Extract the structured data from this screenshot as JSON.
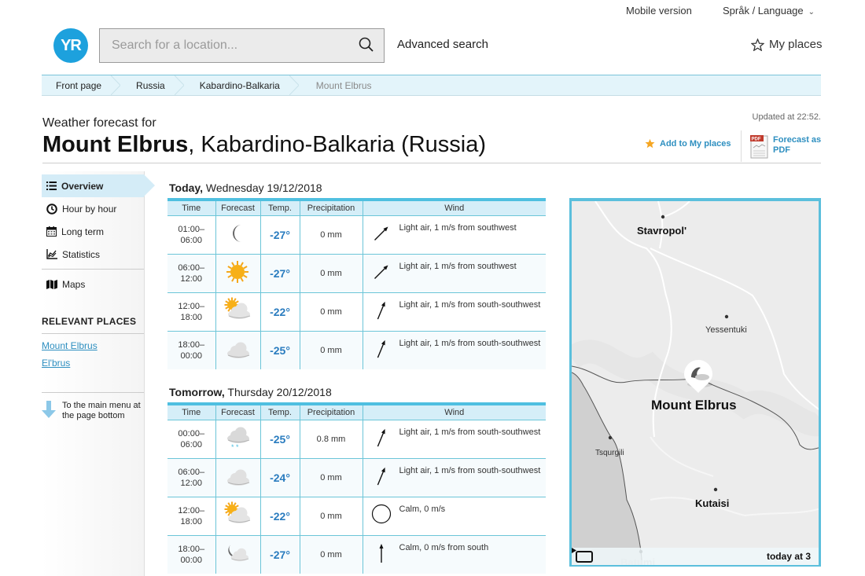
{
  "header": {
    "logo_text": "YR",
    "mobile_version": "Mobile version",
    "language": "Språk / Language",
    "search_placeholder": "Search for a location...",
    "search_value": "",
    "advanced_search": "Advanced search",
    "my_places": "My places"
  },
  "breadcrumb": [
    {
      "label": "Front page"
    },
    {
      "label": "Russia"
    },
    {
      "label": "Kabardino-Balkaria"
    },
    {
      "label": "Mount Elbrus"
    }
  ],
  "page": {
    "pretitle": "Weather forecast for",
    "place_name": "Mount Elbrus",
    "place_region": ", Kabardino-Balkaria (Russia)",
    "updated": "Updated at 22:52.",
    "add_to_my_places": "Add to My places",
    "forecast_pdf_line1": "Forecast as",
    "forecast_pdf_line2": "PDF",
    "pdf_badge": "PDF"
  },
  "sidebar": {
    "items": [
      {
        "label": "Overview",
        "icon": "list-icon",
        "active": true
      },
      {
        "label": "Hour by hour",
        "icon": "clock-icon"
      },
      {
        "label": "Long term",
        "icon": "calendar-icon"
      },
      {
        "label": "Statistics",
        "icon": "chart-icon"
      },
      {
        "label": "Maps",
        "icon": "map-icon"
      }
    ],
    "relevant_heading": "RELEVANT PLACES",
    "relevant_places": [
      "Mount Elbrus",
      "El'brus"
    ],
    "to_main_menu_line1": "To the main menu at",
    "to_main_menu_line2": "the page bottom"
  },
  "table_headers": {
    "time": "Time",
    "forecast": "Forecast",
    "temp": "Temp.",
    "precipitation": "Precipitation",
    "wind": "Wind"
  },
  "days": [
    {
      "day_label": "Today,",
      "date": " Wednesday 19/12/2018",
      "rows": [
        {
          "from": "01:00–",
          "to": "06:00",
          "icon": "moon-icon",
          "temp": "-27°",
          "precip": "0 mm",
          "wind_dir": "southwest",
          "wind": "Light air, 1 m/s from southwest"
        },
        {
          "from": "06:00–",
          "to": "12:00",
          "icon": "sun-icon",
          "temp": "-27°",
          "precip": "0 mm",
          "wind_dir": "southwest",
          "wind": "Light air, 1 m/s from southwest"
        },
        {
          "from": "12:00–",
          "to": "18:00",
          "icon": "partly-cloudy-icon",
          "temp": "-22°",
          "precip": "0 mm",
          "wind_dir": "south-southwest",
          "wind": "Light air, 1 m/s from south-southwest"
        },
        {
          "from": "18:00–",
          "to": "00:00",
          "icon": "cloud-icon",
          "temp": "-25°",
          "precip": "0 mm",
          "wind_dir": "south-southwest",
          "wind": "Light air, 1 m/s from south-southwest"
        }
      ]
    },
    {
      "day_label": "Tomorrow,",
      "date": " Thursday 20/12/2018",
      "rows": [
        {
          "from": "00:00–",
          "to": "06:00",
          "icon": "snow-cloud-icon",
          "temp": "-25°",
          "precip": "0.8 mm",
          "wind_dir": "south-southwest",
          "wind": "Light air, 1 m/s from south-southwest"
        },
        {
          "from": "06:00–",
          "to": "12:00",
          "icon": "cloud-icon",
          "temp": "-24°",
          "precip": "0 mm",
          "wind_dir": "south-southwest",
          "wind": "Light air, 1 m/s from south-southwest"
        },
        {
          "from": "12:00–",
          "to": "18:00",
          "icon": "partly-cloudy-icon",
          "temp": "-22°",
          "precip": "0 mm",
          "wind_dir": "calm",
          "wind": "Calm, 0 m/s"
        },
        {
          "from": "18:00–",
          "to": "00:00",
          "icon": "moon-cloud-icon",
          "temp": "-27°",
          "precip": "0 mm",
          "wind_dir": "south",
          "wind": "Calm, 0 m/s from south"
        }
      ]
    }
  ],
  "map": {
    "labels": [
      "Stavropol'",
      "Yessentuki",
      "Mount Elbrus",
      "Tsqurgili",
      "Kutaisi",
      "Batumi"
    ],
    "time_label": "today at 3"
  },
  "colors": {
    "brand": "#1da1dd",
    "link": "#2e8fc0",
    "temp": "#2a7cbf",
    "table_border": "#4fbfe0",
    "header_bg": "#d5eef8"
  }
}
